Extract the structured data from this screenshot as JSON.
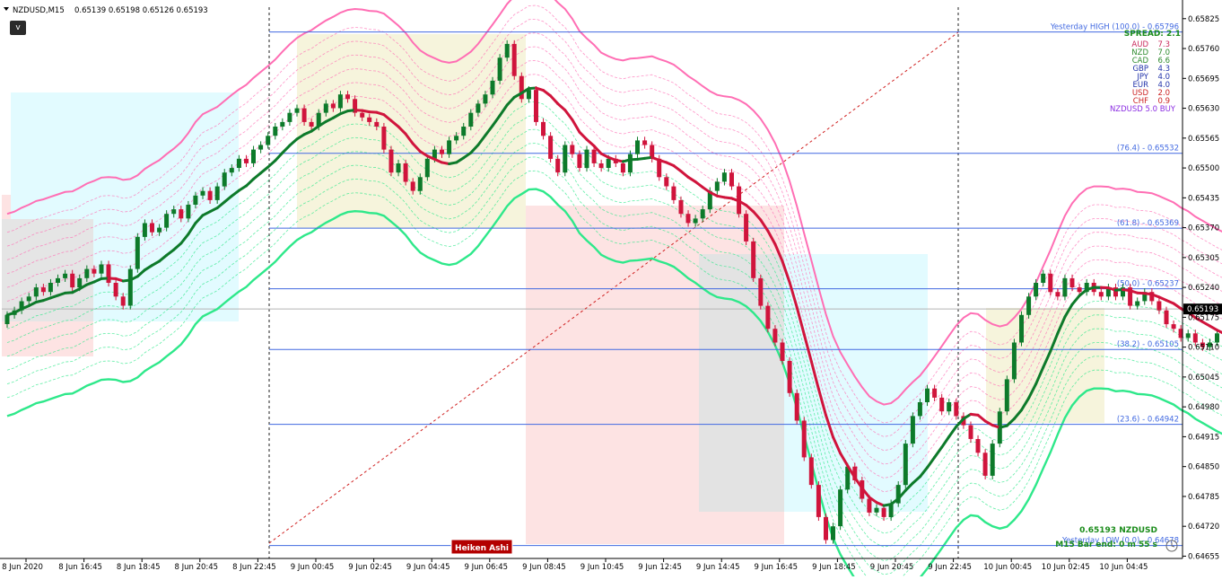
{
  "header": {
    "symbol": "NZDUSD,M15",
    "ohlc": "0.65139 0.65198 0.65126 0.65193"
  },
  "version_button": "v",
  "spread_label": "SPREAD: 2.1",
  "strength": [
    {
      "ccy": "AUD",
      "val": "7.3",
      "color": "#c8285a"
    },
    {
      "ccy": "NZD",
      "val": "7.0",
      "color": "#2e8b2e"
    },
    {
      "ccy": "CAD",
      "val": "6.6",
      "color": "#2e8b2e"
    },
    {
      "ccy": "GBP",
      "val": "4.3",
      "color": "#2233aa"
    },
    {
      "ccy": "JPY",
      "val": "4.0",
      "color": "#2233aa"
    },
    {
      "ccy": "EUR",
      "val": "4.0",
      "color": "#2233aa"
    },
    {
      "ccy": "USD",
      "val": "2.0",
      "color": "#cc2222"
    },
    {
      "ccy": "CHF",
      "val": "0.9",
      "color": "#cc2222"
    }
  ],
  "signal": "NZDUSD 5.0 BUY",
  "fib_labels": [
    {
      "text": "Yesterday HIGH (100.0) - 0.65796",
      "price": 0.65796
    },
    {
      "text": "(76.4) - 0.65532",
      "price": 0.65532
    },
    {
      "text": "(61.8) - 0.65369",
      "price": 0.65369
    },
    {
      "text": "(50.0) - 0.65237",
      "price": 0.65237
    },
    {
      "text": "(38.2) - 0.65105",
      "price": 0.65105
    },
    {
      "text": "(23.6) - 0.64942",
      "price": 0.64942
    },
    {
      "text": "Yesterday LOW (0.0) - 0.64678",
      "price": 0.64678
    }
  ],
  "current_price": "0.65193",
  "bottom_price_text": "0.65193  NZDUSD",
  "bar_end_text": "M15 Bar end: 0 m 55 s",
  "heiken_label": "Heiken Ashi",
  "colors": {
    "bull": "#0d7a2a",
    "bear": "#d0143c",
    "fib": "#4169e1",
    "upper": "#ff6eb4",
    "lower": "#2ee88a"
  },
  "chart_data": {
    "type": "candlestick",
    "y_ticks": [
      "0.65825",
      "0.65760",
      "0.65695",
      "0.65630",
      "0.65565",
      "0.65500",
      "0.65435",
      "0.65370",
      "0.65305",
      "0.65240",
      "0.65175",
      "0.65110",
      "0.65045",
      "0.64980",
      "0.64915",
      "0.64850",
      "0.64785",
      "0.64720",
      "0.64655"
    ],
    "ylim": [
      0.6465,
      0.6585
    ],
    "x_ticks": [
      "8 Jun 2020",
      "8 Jun 16:45",
      "8 Jun 18:45",
      "8 Jun 20:45",
      "8 Jun 22:45",
      "9 Jun 00:45",
      "9 Jun 02:45",
      "9 Jun 04:45",
      "9 Jun 06:45",
      "9 Jun 08:45",
      "9 Jun 10:45",
      "9 Jun 12:45",
      "9 Jun 14:45",
      "9 Jun 16:45",
      "9 Jun 18:45",
      "9 Jun 20:45",
      "9 Jun 22:45",
      "10 Jun 00:45",
      "10 Jun 02:45",
      "10 Jun 04:45"
    ],
    "bars_per_tick": 8,
    "closes": [
      0.6518,
      0.6519,
      0.6521,
      0.6522,
      0.6524,
      0.6523,
      0.6525,
      0.6526,
      0.6527,
      0.6524,
      0.6526,
      0.6528,
      0.6527,
      0.6529,
      0.6525,
      0.6522,
      0.652,
      0.6528,
      0.6535,
      0.6538,
      0.6536,
      0.6537,
      0.654,
      0.6541,
      0.6539,
      0.6542,
      0.6544,
      0.6545,
      0.6543,
      0.6546,
      0.6549,
      0.655,
      0.6552,
      0.6551,
      0.6554,
      0.6555,
      0.6557,
      0.6559,
      0.656,
      0.6562,
      0.6563,
      0.656,
      0.6559,
      0.6562,
      0.6564,
      0.6563,
      0.6566,
      0.6565,
      0.6562,
      0.6561,
      0.656,
      0.6559,
      0.6554,
      0.6549,
      0.6551,
      0.6547,
      0.6545,
      0.6548,
      0.6552,
      0.6554,
      0.6553,
      0.6556,
      0.6557,
      0.6559,
      0.6562,
      0.6564,
      0.6566,
      0.6569,
      0.6574,
      0.6577,
      0.657,
      0.6565,
      0.6567,
      0.656,
      0.6557,
      0.6552,
      0.6549,
      0.6555,
      0.6553,
      0.655,
      0.6554,
      0.6551,
      0.655,
      0.6552,
      0.6551,
      0.6549,
      0.6553,
      0.6556,
      0.6555,
      0.6552,
      0.6548,
      0.6546,
      0.6543,
      0.654,
      0.6538,
      0.6539,
      0.6541,
      0.6545,
      0.6547,
      0.6549,
      0.6546,
      0.654,
      0.6534,
      0.6526,
      0.652,
      0.6515,
      0.6512,
      0.6508,
      0.6501,
      0.6495,
      0.6487,
      0.6481,
      0.6474,
      0.6469,
      0.6472,
      0.648,
      0.6485,
      0.6482,
      0.6478,
      0.6475,
      0.6476,
      0.6474,
      0.6477,
      0.6481,
      0.649,
      0.6496,
      0.6499,
      0.6502,
      0.65,
      0.6497,
      0.6499,
      0.6496,
      0.6494,
      0.6491,
      0.6488,
      0.6483,
      0.649,
      0.6497,
      0.6504,
      0.6512,
      0.6518,
      0.6522,
      0.6525,
      0.6527,
      0.6523,
      0.6522,
      0.6526,
      0.6524,
      0.6523,
      0.6525,
      0.6523,
      0.6522,
      0.6524,
      0.6522,
      0.6524,
      0.652,
      0.6521,
      0.6523,
      0.6521,
      0.6519,
      0.6516,
      0.6515,
      0.6513,
      0.6514,
      0.6512,
      0.6511,
      0.6512,
      0.6514,
      0.6513,
      0.6512,
      0.6508,
      0.6504,
      0.6501,
      0.6504,
      0.6505,
      0.6503,
      0.6504,
      0.6502,
      0.6503,
      0.65,
      0.6498,
      0.65,
      0.6499,
      0.6501,
      0.6502,
      0.6506,
      0.651,
      0.6512,
      0.6516,
      0.6519
    ]
  }
}
